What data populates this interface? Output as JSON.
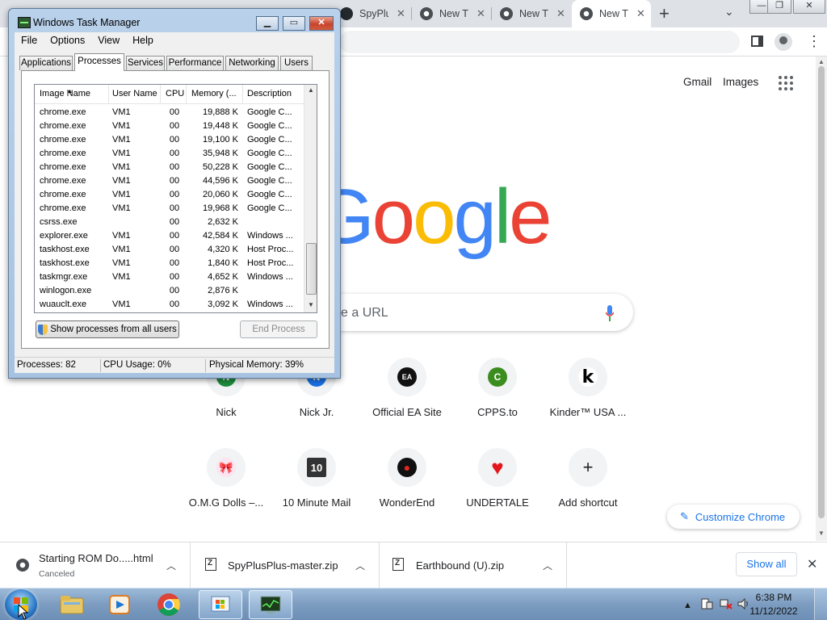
{
  "browser": {
    "tabs": [
      {
        "label": "SpyPlu",
        "icon": "github-icon"
      },
      {
        "label": "New T",
        "icon": "chrome-icon"
      },
      {
        "label": "New T",
        "icon": "chrome-icon"
      },
      {
        "label": "New T",
        "icon": "chrome-icon",
        "active": true
      }
    ],
    "new_tab_glyph": "+",
    "tab_search_glyph": "⌄",
    "window_buttons": [
      "—",
      "❐",
      "✕"
    ],
    "top_links": {
      "gmail": "Gmail",
      "images": "Images"
    },
    "logo_letters": [
      {
        "ch": "G",
        "color": "#4285f4"
      },
      {
        "ch": "o",
        "color": "#ea4335"
      },
      {
        "ch": "o",
        "color": "#fbbc05"
      },
      {
        "ch": "g",
        "color": "#4285f4"
      },
      {
        "ch": "l",
        "color": "#34a853"
      },
      {
        "ch": "e",
        "color": "#ea4335"
      }
    ],
    "search_visible_text": "e a URL",
    "shortcuts": [
      {
        "label": "Nick",
        "icon": "green-dot-icon",
        "badge": "N",
        "color": "#1e8e3e"
      },
      {
        "label": "Nick Jr.",
        "icon": "blue-dot-icon",
        "badge": "N",
        "color": "#1a73e8"
      },
      {
        "label": "Official EA Site",
        "icon": "ea-icon",
        "badge": "EA",
        "color": "#111111"
      },
      {
        "label": "CPPS.to",
        "icon": "cpps-icon",
        "badge": "C",
        "color": "#3c8d1f"
      },
      {
        "label": "Kinder™ USA ...",
        "icon": "kinder-icon",
        "badge": "k",
        "color": "#ffffff"
      },
      {
        "label": "O.M.G Dolls –...",
        "icon": "omg-dolls-icon",
        "badge": "🎀",
        "color": "#ffffff"
      },
      {
        "label": "10 Minute Mail",
        "icon": "ten-minute-mail-icon",
        "badge": "10",
        "color": "#333333"
      },
      {
        "label": "WonderEnd",
        "icon": "wonderend-icon",
        "badge": "●",
        "color": "#111111"
      },
      {
        "label": "UNDERTALE",
        "icon": "heart-icon",
        "badge": "♥",
        "color": "#ffffff"
      },
      {
        "label": "Add shortcut",
        "icon": "plus-icon",
        "badge": "+",
        "color": "#f1f3f4"
      }
    ],
    "customize_label": "Customize Chrome"
  },
  "downloads": {
    "items": [
      {
        "name": "Starting ROM Do.....html",
        "status": "Canceled",
        "icon": "chrome-icon"
      },
      {
        "name": "SpyPlusPlus-master.zip",
        "status": "",
        "icon": "zip-icon"
      },
      {
        "name": "Earthbound (U).zip",
        "status": "",
        "icon": "zip-icon"
      }
    ],
    "show_all": "Show all",
    "close_glyph": "✕"
  },
  "task_manager": {
    "title": "Windows Task Manager",
    "menu": [
      "File",
      "Options",
      "View",
      "Help"
    ],
    "tabs": [
      "Applications",
      "Processes",
      "Services",
      "Performance",
      "Networking",
      "Users"
    ],
    "active_tab": "Processes",
    "columns": [
      "Image Name",
      "User Name",
      "CPU",
      "Memory (...",
      "Description"
    ],
    "rows": [
      [
        "chrome.exe",
        "VM1",
        "00",
        "19,888 K",
        "Google C..."
      ],
      [
        "chrome.exe",
        "VM1",
        "00",
        "19,448 K",
        "Google C..."
      ],
      [
        "chrome.exe",
        "VM1",
        "00",
        "19,100 K",
        "Google C..."
      ],
      [
        "chrome.exe",
        "VM1",
        "00",
        "35,948 K",
        "Google C..."
      ],
      [
        "chrome.exe",
        "VM1",
        "00",
        "50,228 K",
        "Google C..."
      ],
      [
        "chrome.exe",
        "VM1",
        "00",
        "44,596 K",
        "Google C..."
      ],
      [
        "chrome.exe",
        "VM1",
        "00",
        "20,060 K",
        "Google C..."
      ],
      [
        "chrome.exe",
        "VM1",
        "00",
        "19,968 K",
        "Google C..."
      ],
      [
        "csrss.exe",
        "",
        "00",
        "2,632 K",
        ""
      ],
      [
        "explorer.exe",
        "VM1",
        "00",
        "42,584 K",
        "Windows ..."
      ],
      [
        "taskhost.exe",
        "VM1",
        "00",
        "4,320 K",
        "Host Proc..."
      ],
      [
        "taskhost.exe",
        "VM1",
        "00",
        "1,840 K",
        "Host Proc..."
      ],
      [
        "taskmgr.exe",
        "VM1",
        "00",
        "4,652 K",
        "Windows ..."
      ],
      [
        "winlogon.exe",
        "",
        "00",
        "2,876 K",
        ""
      ],
      [
        "wuauclt.exe",
        "VM1",
        "00",
        "3,092 K",
        "Windows ..."
      ]
    ],
    "show_all_button": "Show processes from all users",
    "end_process_button": "End Process",
    "status": {
      "processes": "Processes: 82",
      "cpu": "CPU Usage: 0%",
      "memory": "Physical Memory: 39%"
    }
  },
  "taskbar": {
    "pinned": [
      {
        "name": "explorer-icon"
      },
      {
        "name": "media-player-icon"
      },
      {
        "name": "chrome-icon"
      },
      {
        "name": "windows-update-icon"
      },
      {
        "name": "task-manager-icon"
      }
    ],
    "time": "6:38 PM",
    "date": "11/12/2022"
  }
}
